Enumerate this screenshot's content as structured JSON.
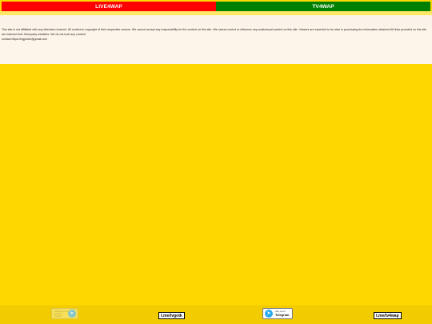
{
  "topbar": {
    "left_label": "LIVE4WAP",
    "right_label": "TV4WAP",
    "left_color": "#FF0000",
    "right_color": "#008000"
  },
  "notice": {
    "disclaimer": "This site is not affiliated with any television channel. All content in copyright of their respective owners. We cannot accept any responsibility for the content on this site. We cannot control or influence any audiovisual content on this site. Viewers are expected to be wise in processing the information obtained.All links provided on this site are indexed from third-party websites. We do not host any content",
    "contact": "contact:https://tvgplobe@gmail.com"
  },
  "footer": {
    "faded_badge_text": "subscribe to our telegram channel",
    "telegram_badge_small": "Join us on",
    "telegram_badge_big": "Telegram",
    "link1": "t.me/tvgotk",
    "link2": "t.me/tv4wap",
    "telegram_icon": "telegram-icon",
    "telegram_color": "#2AABEE"
  },
  "colors": {
    "page_background": "#FFD700",
    "footer_background": "#F2CC00",
    "notice_background": "#FEF5EA"
  }
}
